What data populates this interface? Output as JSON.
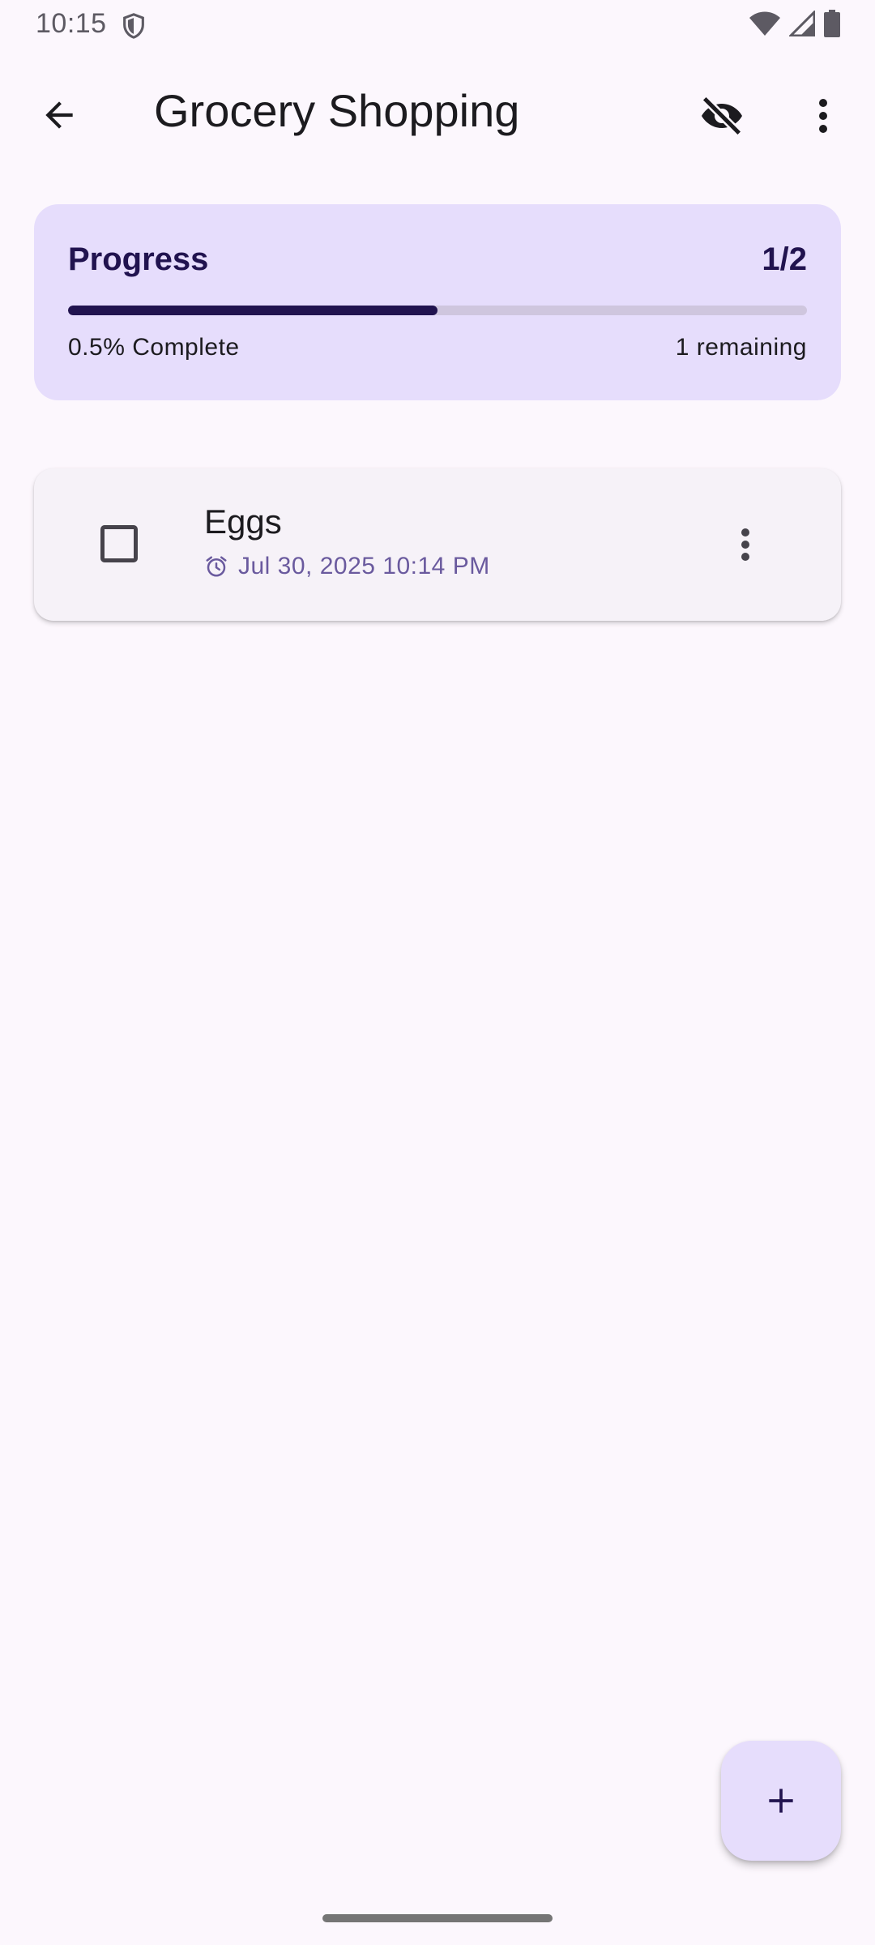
{
  "status_bar": {
    "time": "10:15",
    "icons": [
      "shield-icon",
      "wifi-icon",
      "cellular-signal-icon",
      "battery-icon"
    ]
  },
  "app_bar": {
    "title": "Grocery Shopping",
    "back_icon": "arrow-back-icon",
    "hide_icon": "visibility-off-icon",
    "more_icon": "more-vert-icon"
  },
  "progress": {
    "title": "Progress",
    "count": "1/2",
    "fraction_complete": 0.5,
    "complete_label": "0.5% Complete",
    "remaining_label": "1 remaining"
  },
  "tasks": [
    {
      "name": "Eggs",
      "checked": false,
      "due": "Jul 30, 2025 10:14 PM",
      "due_icon": "alarm-icon",
      "menu_icon": "more-vert-icon"
    }
  ],
  "fab": {
    "icon": "add-icon"
  },
  "colors": {
    "background": "#FCF7FD",
    "card_accent": "#E6DDFC",
    "primary_dark": "#21134F",
    "date_text": "#6A5A9E"
  }
}
